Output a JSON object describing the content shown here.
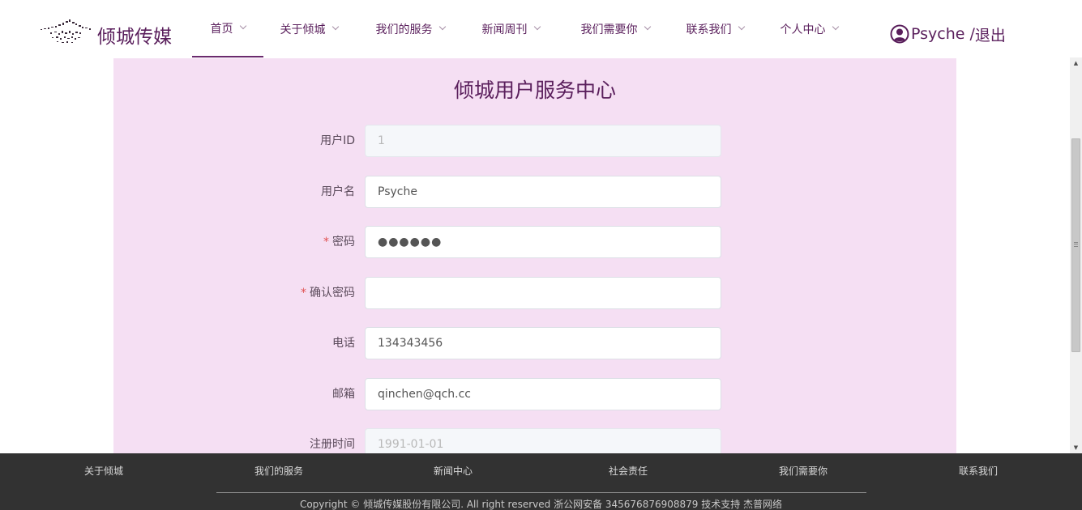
{
  "header": {
    "brand": "倾城传媒",
    "nav": [
      {
        "label": "首页",
        "active": true
      },
      {
        "label": "关于倾城"
      },
      {
        "label": "我们的服务"
      },
      {
        "label": "新闻周刊"
      },
      {
        "label": "我们需要你"
      },
      {
        "label": "联系我们"
      },
      {
        "label": "个人中心"
      }
    ],
    "user": {
      "name": "Psyche",
      "separator": " /",
      "logout": "退出"
    }
  },
  "main": {
    "title": "倾城用户服务中心",
    "fields": [
      {
        "label": "用户ID",
        "required": false,
        "value": "1",
        "disabled": true
      },
      {
        "label": "用户名",
        "required": false,
        "value": "Psyche",
        "disabled": false
      },
      {
        "label": "密码",
        "required": true,
        "value": "●●●●●●",
        "disabled": false
      },
      {
        "label": "确认密码",
        "required": true,
        "value": "",
        "disabled": false
      },
      {
        "label": "电话",
        "required": false,
        "value": "134343456",
        "disabled": false
      },
      {
        "label": "邮箱",
        "required": false,
        "value": "qinchen@qch.cc",
        "disabled": false
      },
      {
        "label": "注册时间",
        "required": false,
        "value": "1991-01-01",
        "disabled": true
      }
    ],
    "required_mark": "*"
  },
  "footer": {
    "links": [
      "关于倾城",
      "我们的服务",
      "新闻中心",
      "社会责任",
      "我们需要你",
      "联系我们"
    ],
    "copyright": "Copyright © 倾城传媒股份有限公司. All right reserved  浙公网安备 345676876908879 技术支持 杰普网络"
  },
  "colors": {
    "brand": "#5a1f5c",
    "main_bg": "#f5dff3",
    "footer_bg": "#323232",
    "required": "#e05050"
  }
}
